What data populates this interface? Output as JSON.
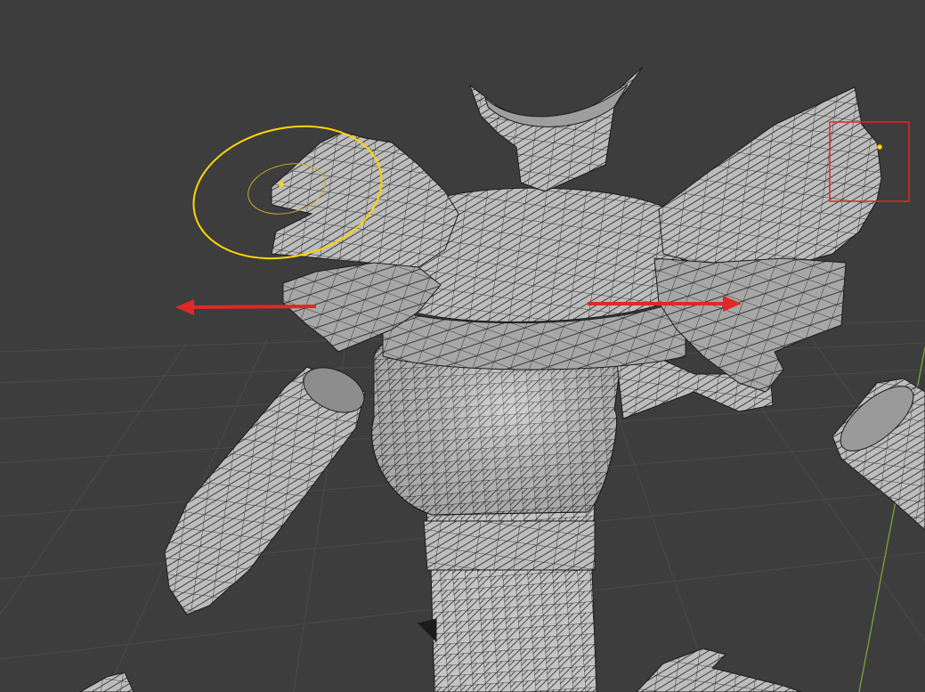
{
  "viewport": {
    "name": "3d-viewport",
    "mode": "edit-mode-proportional-editing",
    "background_color": "#3d3d3d",
    "grid_color": "#4a4a4a",
    "mesh_face_color": "#b9b9b9",
    "mesh_edge_color": "#1a1a1a",
    "y_axis_color": "#7ea33a"
  },
  "annotations": {
    "proportional_falloff_color": "#ffd500",
    "selection_box_color": "#e02828",
    "arrow_color": "#e02828",
    "arrows": [
      "move-left-arrow",
      "move-right-arrow"
    ]
  },
  "selected_vertices": [
    "left-shoulder-vertex",
    "right-shoulder-vertex"
  ]
}
